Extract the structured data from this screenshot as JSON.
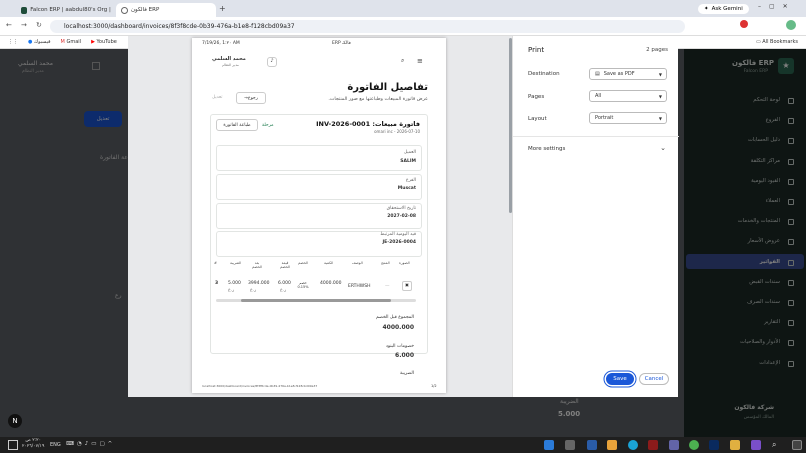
{
  "browser": {
    "tabs": [
      {
        "title": "Falcon ERP | aabdul80's Org | S..."
      },
      {
        "title": "فالكون ERP",
        "active": true
      }
    ],
    "ask_gemini": "Ask Gemini",
    "url": "localhost:3000/dashboard/invoices/8f3f8cde-0b39-476a-b1e8-f128cbd09a37",
    "bookmarks": [
      "فيسبوك",
      "Gmail",
      "YouTube"
    ],
    "all_bookmarks": "All Bookmarks"
  },
  "sidebar": {
    "brand_title": "فالكون ERP",
    "brand_subtitle": "Falcon ERP",
    "items": [
      "لوحة التحكم",
      "الفروع",
      "دليل الحسابات",
      "مراكز التكلفة",
      "القيود اليومية",
      "العملاء",
      "المنتجات والخدمات",
      "عروض الأسعار",
      "الفواتير",
      "سندات القبض",
      "سندات الصرف",
      "التقارير",
      "الأدوار والصلاحيات",
      "الإعدادات"
    ],
    "active_index": 8,
    "org_name": "شركة فالكون",
    "org_sub": "المالك المؤسس"
  },
  "background": {
    "user_name": "محمد السلمي",
    "user_role": "مدير النظام",
    "edit_button": "تعديل",
    "section_label": "اعة الفاتورة",
    "tax_label": "الضريبة",
    "tax_value": "5.000",
    "side_label": "رع"
  },
  "preview": {
    "header_time": "7/19/26, 1:۲۰ AM",
    "header_title": "فالكـ ERP",
    "user_name": "محمد السلمي",
    "user_role": "مدير النظام",
    "title": "تفاصيل الفاتورة",
    "subtitle": "عرض فاتورة المبيعات وطباعتها مع صور المنتجات.",
    "back_button": "رجوع",
    "edit_link": "تعديل",
    "invoice_heading": "فاتورة مبيعات: INV-2026-0001",
    "invoice_meta": "omari inc - 2026-07-10",
    "status": "مرحلة",
    "print_button": "طباعة الفاتورة",
    "fields": [
      {
        "label": "العميل",
        "value": "SALIM"
      },
      {
        "label": "الفرع",
        "value": "Muscat"
      },
      {
        "label": "تاريخ الاستحقاق",
        "value": "2027-02-08"
      },
      {
        "label": "قيد اليومية المرتبط",
        "value": "JE-2026-0004"
      }
    ],
    "table_headers": [
      "الصورة",
      "المنتج",
      "الوصف",
      "الكمية",
      "الخصم",
      "قيمة الخصم",
      "بعد الخصم",
      "الضريبة",
      "#"
    ],
    "table_row": {
      "description": "ERTHWSH",
      "quantity": "4000.000",
      "discount": "خصم %0.15",
      "discount_value": "6.000",
      "after_discount": "3994.000",
      "tax": "5.000",
      "index": "3",
      "currency": "ر.ع"
    },
    "subtotal_label": "المجموع قبل الخصم",
    "subtotal_value": "4000.000",
    "line_discounts_label": "خصومات البنود",
    "line_discounts_value": "6.000",
    "tax_label": "الضريبة",
    "footer_url": "localhost:3000/dashboard/invoices/8f3f8cde-0b39-476a-b1e8-f128cbd09a37",
    "footer_page": "1/2"
  },
  "print_dialog": {
    "title": "Print",
    "pages_count": "2 pages",
    "destination_label": "Destination",
    "destination_value": "Save as PDF",
    "pages_label": "Pages",
    "pages_value": "All",
    "layout_label": "Layout",
    "layout_value": "Portrait",
    "more_settings": "More settings",
    "save_button": "Save",
    "cancel_button": "Cancel"
  },
  "taskbar": {
    "language": "ENG",
    "time_line1": "٢:٢٠ ص",
    "time_line2": "٢٠٢٦/٠٧/١٩"
  }
}
